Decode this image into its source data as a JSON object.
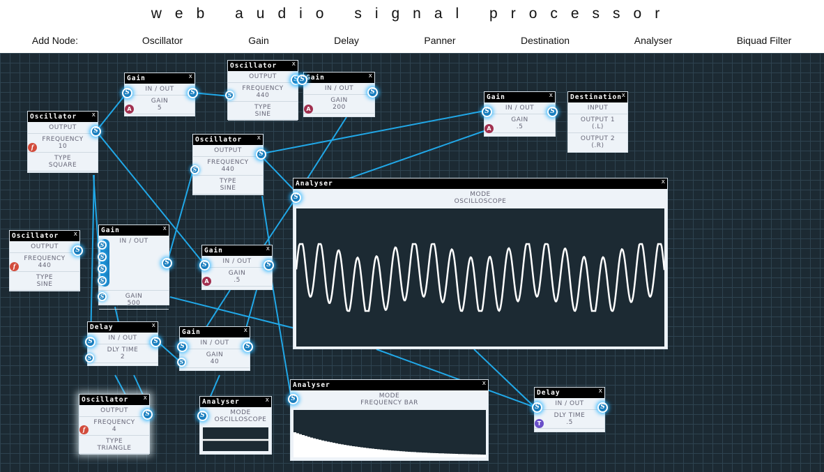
{
  "app": {
    "title": "web audio signal processor",
    "add_node_label": "Add Node:",
    "menu": [
      "Oscillator",
      "Gain",
      "Delay",
      "Panner",
      "Destination",
      "Analyser",
      "Biquad Filter"
    ]
  },
  "colors": {
    "canvas_bg": "#1c2a33",
    "grid": "#2e4350",
    "wire": "#21a8e8",
    "port": "#1a7fbf",
    "node_bg": "#eef3f8"
  },
  "labels": {
    "output": "OUTPUT",
    "input": "INPUT",
    "in_out": "IN / OUT",
    "frequency": "FREQUENCY",
    "type": "TYPE",
    "gain": "GAIN",
    "mode": "MODE",
    "dly_time": "DLY TIME",
    "output1": "OUTPUT 1",
    "output2": "OUTPUT 2",
    "close": "x"
  },
  "nodes": {
    "osc1": {
      "title": "Oscillator",
      "frequency": "10",
      "type": "SQUARE"
    },
    "osc2": {
      "title": "Oscillator",
      "frequency": "440",
      "type": "SINE"
    },
    "osc3": {
      "title": "Oscillator",
      "frequency": "440",
      "type": "SINE"
    },
    "osc4": {
      "title": "Oscillator",
      "frequency": "440",
      "type": "SINE"
    },
    "osc5": {
      "title": "Oscillator",
      "frequency": "4",
      "type": "TRIANGLE"
    },
    "gain1": {
      "title": "Gain",
      "gain": "5"
    },
    "gain2": {
      "title": "Gain",
      "gain": "200"
    },
    "gain3": {
      "title": "Gain",
      "gain": ".5"
    },
    "gain4": {
      "title": "Gain",
      "gain": "500"
    },
    "gain5": {
      "title": "Gain",
      "gain": ".5"
    },
    "gain6": {
      "title": "Gain",
      "gain": "40"
    },
    "dest": {
      "title": "Destination",
      "output1_value": "(.L)",
      "output2_value": "(.R)"
    },
    "analyser1": {
      "title": "Analyser",
      "mode": "OSCILLOSCOPE"
    },
    "analyser2": {
      "title": "Analyser",
      "mode": "FREQUENCY BAR"
    },
    "analyser3": {
      "title": "Analyser",
      "mode": "OSCILLOSCOPE"
    },
    "delay1": {
      "title": "Delay",
      "dly_time": "2"
    },
    "delay2": {
      "title": "Delay",
      "dly_time": ".5"
    }
  },
  "port_glyphs": {
    "signal": "S",
    "frequency": "f",
    "amplitude": "A",
    "time": "T"
  }
}
